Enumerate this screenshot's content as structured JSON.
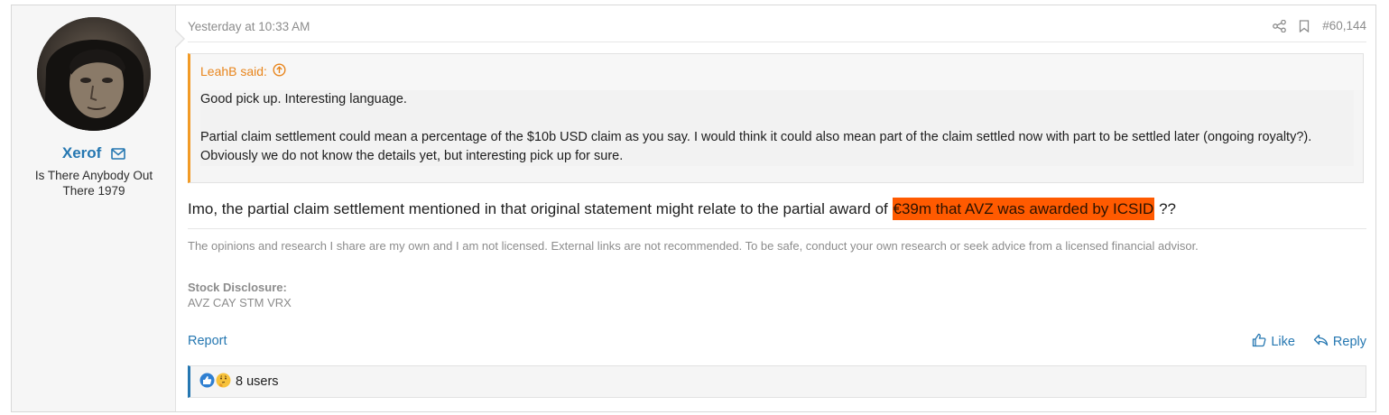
{
  "post": {
    "date": "Yesterday at 10:33 AM",
    "number": "#60,144",
    "icons": {
      "share": "share-icon",
      "bookmark": "bookmark-icon"
    }
  },
  "user": {
    "name": "Xerof",
    "title": "Is There Anybody Out There 1979",
    "avatar": "user-avatar",
    "mail_icon": "envelope-icon"
  },
  "quote": {
    "author": "LeahB said:",
    "paragraphs": [
      "Good pick up. Interesting language.",
      "Partial claim settlement could mean a percentage of the $10b USD claim as you say. I would think it could also mean part of the claim settled now with part to be settled later (ongoing royalty?). Obviously we do not know the details yet, but interesting pick up for sure."
    ]
  },
  "body": {
    "before": "Imo, the partial claim settlement mentioned in that original statement might relate to the partial award of ",
    "highlight": "€39m that AVZ was awarded by ICSID",
    "after": " ??"
  },
  "signature": {
    "text": "The opinions and research I share are my own and I am not licensed. External links are not recommended. To be safe, conduct your own research or seek advice from a licensed financial advisor.",
    "disclosure_label": "Stock Disclosure:",
    "disclosure_value": "AVZ CAY STM VRX"
  },
  "footer": {
    "report": "Report",
    "like": "Like",
    "reply": "Reply"
  },
  "reactions": {
    "summary": "8 users"
  },
  "colors": {
    "link": "#2577b1",
    "quote_accent": "#f29b26",
    "highlight": "#ff5a00"
  }
}
